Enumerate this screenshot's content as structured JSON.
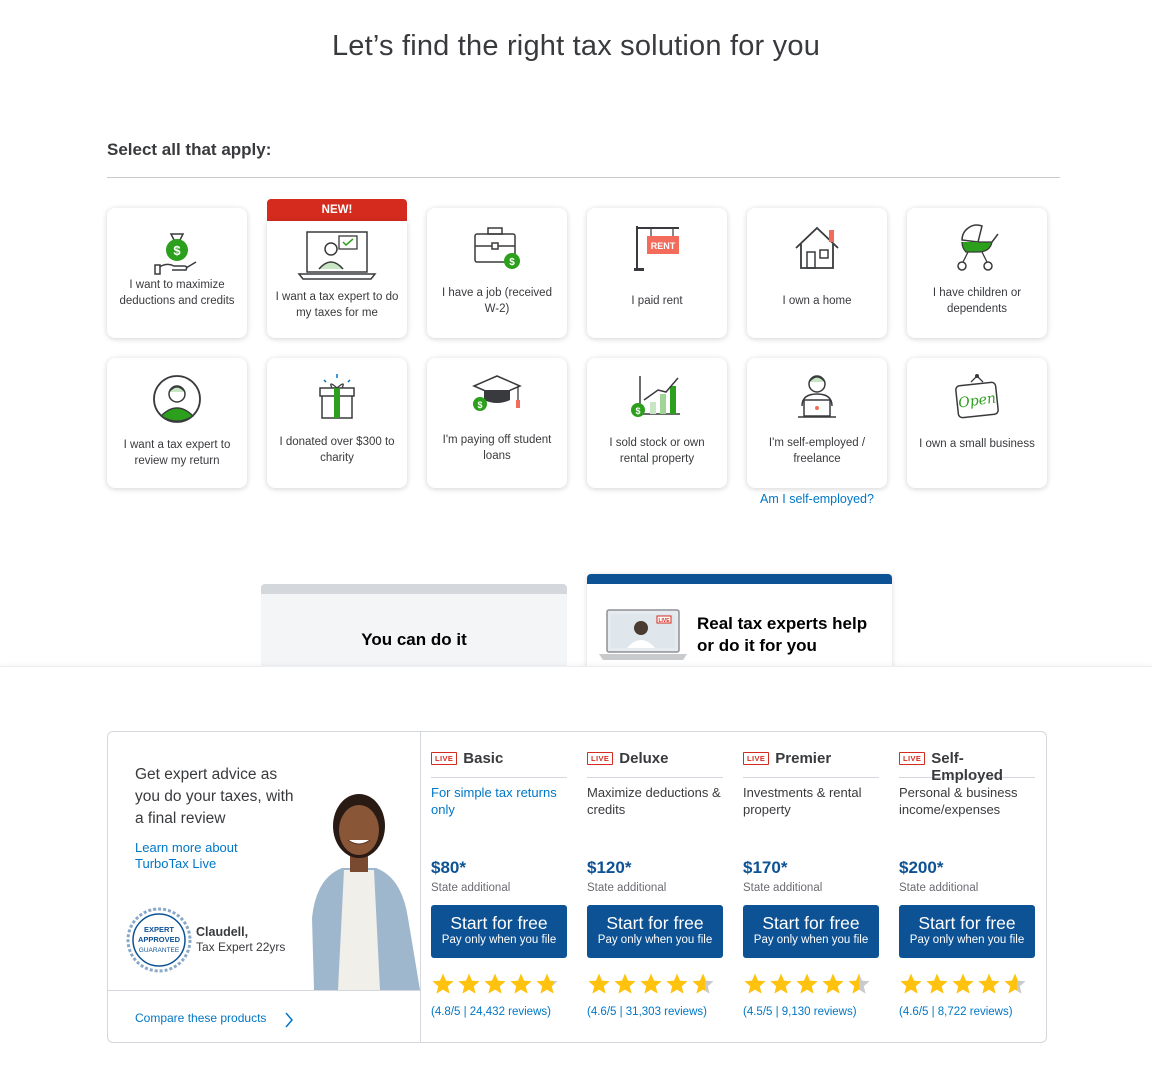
{
  "title": "Let’s find the right tax solution for you",
  "select_label": "Select all that apply:",
  "new_badge": "NEW!",
  "options": [
    {
      "label": "I want to maximize deductions and credits",
      "icon": "money-bag-hand-icon"
    },
    {
      "label": "I want a tax expert to do my taxes for me",
      "icon": "laptop-expert-icon"
    },
    {
      "label": "I have a job (received W-2)",
      "icon": "briefcase-icon"
    },
    {
      "label": "I paid rent",
      "icon": "rent-sign-icon"
    },
    {
      "label": "I own a home",
      "icon": "house-icon"
    },
    {
      "label": "I have children or dependents",
      "icon": "stroller-icon"
    },
    {
      "label": "I want a tax expert to review my return",
      "icon": "expert-person-icon"
    },
    {
      "label": "I donated over $300 to charity",
      "icon": "gift-icon"
    },
    {
      "label": "I'm paying off student loans",
      "icon": "graduation-cap-icon"
    },
    {
      "label": "I sold stock or own rental property",
      "icon": "growth-chart-icon"
    },
    {
      "label": "I'm self-employed / freelance",
      "icon": "freelancer-laptop-icon"
    },
    {
      "label": "I own a small business",
      "icon": "open-sign-icon"
    }
  ],
  "self_employed_link": "Am I self-employed?",
  "tabs": {
    "diy": "You can do it",
    "expert": "Real tax experts help or do it for you"
  },
  "live_panel": {
    "advice": "Get expert advice as you do your taxes, with a final review",
    "learn_more": "Learn more about TurboTax Live",
    "seal": [
      "EXPERT",
      "APPROVED",
      "GUARANTEE"
    ],
    "expert_name": "Claudell,",
    "expert_title": "Tax Expert 22yrs",
    "compare": "Compare these products"
  },
  "live_label": "LIVE",
  "products": [
    {
      "name": "Basic",
      "desc": "For simple tax returns only",
      "price": "$80*",
      "state": "State additional",
      "cta": "Start for free",
      "cta_sub": "Pay only when you file",
      "rating": 4.8,
      "reviews": "(4.8/5 | 24,432 reviews)"
    },
    {
      "name": "Deluxe",
      "desc": "Maximize deductions & credits",
      "price": "$120*",
      "state": "State additional",
      "cta": "Start for free",
      "cta_sub": "Pay only when you file",
      "rating": 4.6,
      "reviews": "(4.6/5 | 31,303 reviews)"
    },
    {
      "name": "Premier",
      "desc": "Investments & rental property",
      "price": "$170*",
      "state": "State additional",
      "cta": "Start for free",
      "cta_sub": "Pay only when you file",
      "rating": 4.5,
      "reviews": "(4.5/5 | 9,130 reviews)"
    },
    {
      "name": "Self-Employed",
      "desc": "Personal & business income/expenses",
      "price": "$200*",
      "state": "State additional",
      "cta": "Start for free",
      "cta_sub": "Pay only when you file",
      "rating": 4.6,
      "reviews": "(4.6/5 | 8,722 reviews)"
    }
  ],
  "colors": {
    "primary": "#0d5294",
    "link": "#0077c5",
    "green": "#2ca01c",
    "red": "#d52b1e",
    "star": "#ffc20e"
  }
}
